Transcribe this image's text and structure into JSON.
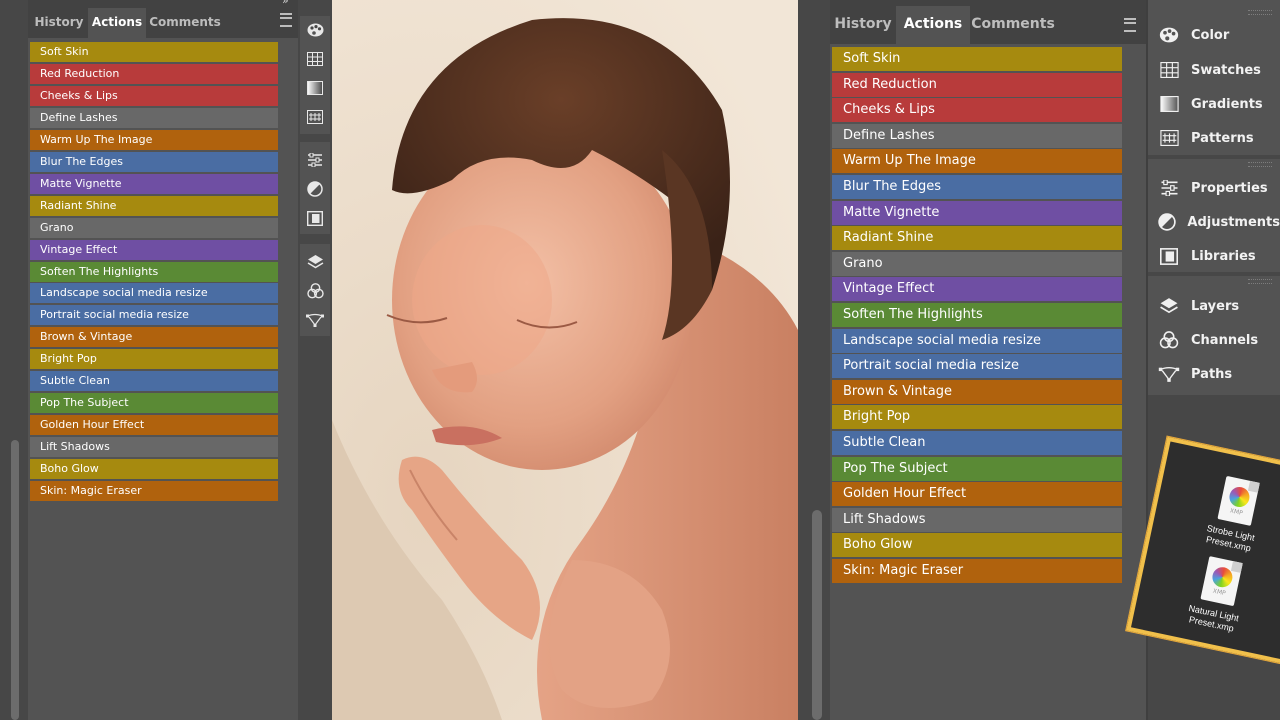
{
  "tabs": [
    {
      "label": "History"
    },
    {
      "label": "Actions",
      "active": true
    },
    {
      "label": "Comments"
    }
  ],
  "actions": [
    {
      "label": "Soft Skin",
      "color": "#a68a0f"
    },
    {
      "label": "Red Reduction",
      "color": "#b83b3b"
    },
    {
      "label": "Cheeks & Lips",
      "color": "#b83b3b"
    },
    {
      "label": "Define Lashes",
      "color": "#686868"
    },
    {
      "label": "Warm Up The Image",
      "color": "#b0620d"
    },
    {
      "label": "Blur The Edges",
      "color": "#4a6da3"
    },
    {
      "label": "Matte Vignette",
      "color": "#6f4fa3"
    },
    {
      "label": "Radiant Shine",
      "color": "#a68a0f"
    },
    {
      "label": "Grano",
      "color": "#686868"
    },
    {
      "label": "Vintage Effect",
      "color": "#6f4fa3"
    },
    {
      "label": "Soften The Highlights",
      "color": "#5a8a35"
    },
    {
      "label": "Landscape social media resize",
      "color": "#4a6da3"
    },
    {
      "label": "Portrait social media resize",
      "color": "#4a6da3"
    },
    {
      "label": "Brown & Vintage",
      "color": "#b0620d"
    },
    {
      "label": "Bright Pop",
      "color": "#a68a0f"
    },
    {
      "label": "Subtle Clean",
      "color": "#4a6da3"
    },
    {
      "label": "Pop The Subject",
      "color": "#5a8a35"
    },
    {
      "label": "Golden Hour Effect",
      "color": "#b0620d"
    },
    {
      "label": "Lift Shadows",
      "color": "#686868"
    },
    {
      "label": "Boho Glow",
      "color": "#a68a0f"
    },
    {
      "label": "Skin: Magic Eraser",
      "color": "#b0620d"
    }
  ],
  "toolbar": {
    "icons": [
      "color-icon",
      "swatches-icon",
      "gradients-icon",
      "patterns-icon",
      "properties-icon",
      "adjustments-icon",
      "libraries-icon",
      "layers-icon",
      "channels-icon",
      "paths-icon"
    ]
  },
  "dock": {
    "items": [
      {
        "label": "Color",
        "icon": "color-icon"
      },
      {
        "label": "Swatches",
        "icon": "swatches-icon"
      },
      {
        "label": "Gradients",
        "icon": "gradients-icon"
      },
      {
        "label": "Patterns",
        "icon": "patterns-icon"
      },
      {
        "label": "Properties",
        "icon": "properties-icon"
      },
      {
        "label": "Adjustments",
        "icon": "adjustments-icon"
      },
      {
        "label": "Libraries",
        "icon": "libraries-icon"
      },
      {
        "label": "Layers",
        "icon": "layers-icon"
      },
      {
        "label": "Channels",
        "icon": "channels-icon"
      },
      {
        "label": "Paths",
        "icon": "paths-icon"
      }
    ]
  },
  "files": [
    {
      "name": "Strobe Light Preset.xmp",
      "ext": "XMP"
    },
    {
      "name": "Natural Light Preset.xmp",
      "ext": "XMP"
    }
  ],
  "colors": {
    "panel_bg": "#535353",
    "tab_bar": "#424242",
    "accent_frame": "#f1c04b"
  }
}
